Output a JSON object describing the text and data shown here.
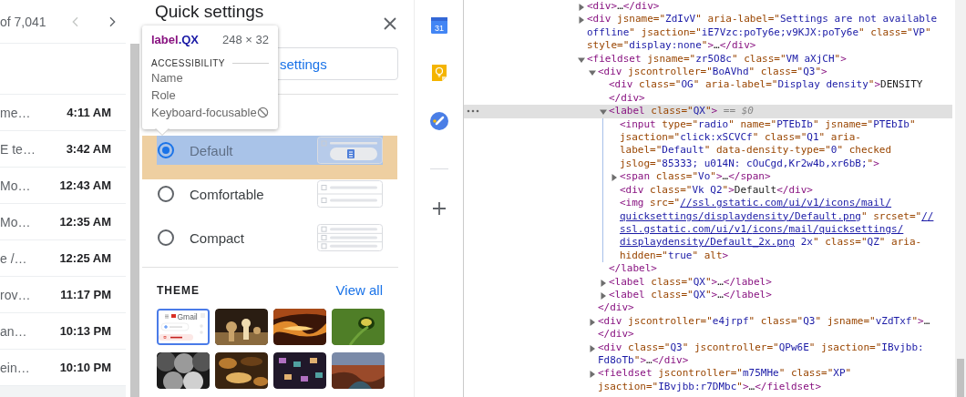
{
  "mail": {
    "count": "of 7,041",
    "nav": [
      {
        "kind": "prev",
        "disabled": true
      },
      {
        "kind": "next",
        "disabled": false
      }
    ],
    "rows": [
      {
        "snippet": "me…",
        "time": "4:11 AM",
        "unread": true
      },
      {
        "snippet": "E te…",
        "time": "3:42 AM",
        "unread": true
      },
      {
        "snippet": "Mo…",
        "time": "12:43 AM",
        "unread": true
      },
      {
        "snippet": "Mo…",
        "time": "12:35 AM",
        "unread": true
      },
      {
        "snippet": "e /…",
        "time": "12:25 AM",
        "unread": true
      },
      {
        "snippet": "rov…",
        "time": "11:17 PM",
        "unread": true
      },
      {
        "snippet": "an…",
        "time": "10:13 PM",
        "unread": true
      },
      {
        "snippet": "ein…",
        "time": "10:10 PM",
        "unread": true
      }
    ]
  },
  "quick_settings": {
    "title": "Quick settings",
    "settings_button": "settings",
    "density": [
      {
        "kind": "default",
        "label": "Default",
        "selected": true,
        "inspected": true
      },
      {
        "kind": "comfortable",
        "label": "Comfortable",
        "selected": false,
        "inspected": false
      },
      {
        "kind": "compact",
        "label": "Compact",
        "selected": false,
        "inspected": false
      }
    ],
    "theme_heading": "THEME",
    "view_all": "View all",
    "themes": [
      {
        "kind": "preview",
        "label": "Gmail",
        "selected": true
      },
      {
        "kind": "picture",
        "selected": false
      },
      {
        "kind": "picture",
        "selected": false
      },
      {
        "kind": "picture",
        "selected": false
      },
      {
        "kind": "picture",
        "selected": false
      },
      {
        "kind": "picture",
        "selected": false
      },
      {
        "kind": "picture",
        "selected": false
      },
      {
        "kind": "picture",
        "selected": false
      }
    ]
  },
  "inspect_tooltip": {
    "tag": "label",
    "class_name": ".QX",
    "size": "248 × 32",
    "section": "ACCESSIBILITY",
    "rows": [
      "Name",
      "Role",
      "Keyboard-focusable"
    ]
  },
  "side_rail": [
    {
      "kind": "calendar",
      "label": "31"
    },
    {
      "kind": "keep"
    },
    {
      "kind": "tasks"
    },
    {
      "kind": "divider"
    },
    {
      "kind": "add"
    }
  ],
  "devtools": {
    "nodes": [
      {
        "expanded": false,
        "tokens": [
          {
            "kind": "tag",
            "text": "<div>"
          },
          {
            "kind": "text",
            "text": "…"
          },
          {
            "kind": "tag",
            "text": "</div>"
          }
        ]
      },
      {
        "expanded": false,
        "tokens": [
          {
            "kind": "tag",
            "text": "<div"
          },
          {
            "kind": "attr",
            "text": " jsname=\""
          },
          {
            "kind": "value",
            "text": "ZdIvV"
          },
          {
            "kind": "attr",
            "text": "\" aria-label=\""
          },
          {
            "kind": "value",
            "text": "Settings are not available offline"
          },
          {
            "kind": "attr",
            "text": "\" jsaction=\""
          },
          {
            "kind": "value",
            "text": "iE7Vzc:poTy6e;v9KJX:poTy6e"
          },
          {
            "kind": "attr",
            "text": "\" class=\""
          },
          {
            "kind": "value",
            "text": "VP"
          },
          {
            "kind": "attr",
            "text": "\" style=\""
          },
          {
            "kind": "value",
            "text": "display:none"
          },
          {
            "kind": "attr",
            "text": "\""
          },
          {
            "kind": "tag",
            "text": ">"
          },
          {
            "kind": "text",
            "text": "…"
          },
          {
            "kind": "tag",
            "text": "</div>"
          }
        ]
      },
      {
        "expanded": true,
        "tokens": [
          {
            "kind": "tag",
            "text": "<fieldset"
          },
          {
            "kind": "attr",
            "text": " jsname=\""
          },
          {
            "kind": "value",
            "text": "zr5O8c"
          },
          {
            "kind": "attr",
            "text": "\" class=\""
          },
          {
            "kind": "value",
            "text": "VM aXjCH"
          },
          {
            "kind": "attr",
            "text": "\""
          },
          {
            "kind": "tag",
            "text": ">"
          }
        ],
        "children": [
          {
            "expanded": true,
            "tokens": [
              {
                "kind": "tag",
                "text": "<div"
              },
              {
                "kind": "attr",
                "text": " jscontroller=\""
              },
              {
                "kind": "value",
                "text": "BoAVhd"
              },
              {
                "kind": "attr",
                "text": "\" class=\""
              },
              {
                "kind": "value",
                "text": "Q3"
              },
              {
                "kind": "attr",
                "text": "\""
              },
              {
                "kind": "tag",
                "text": ">"
              }
            ],
            "close": [
              {
                "kind": "tag",
                "text": "</div>"
              }
            ],
            "children": [
              {
                "tokens": [
                  {
                    "kind": "tag",
                    "text": "<div"
                  },
                  {
                    "kind": "attr",
                    "text": " class=\""
                  },
                  {
                    "kind": "value",
                    "text": "OG"
                  },
                  {
                    "kind": "attr",
                    "text": "\" aria-label=\""
                  },
                  {
                    "kind": "value",
                    "text": "Display density"
                  },
                  {
                    "kind": "attr",
                    "text": "\""
                  },
                  {
                    "kind": "tag",
                    "text": ">"
                  },
                  {
                    "kind": "text",
                    "text": "DENSITY"
                  }
                ],
                "close": [
                  {
                    "kind": "tag",
                    "text": "</div>"
                  }
                ]
              },
              {
                "expanded": true,
                "selected": true,
                "tokens": [
                  {
                    "kind": "tag",
                    "text": "<label"
                  },
                  {
                    "kind": "attr",
                    "text": " class=\""
                  },
                  {
                    "kind": "value",
                    "text": "QX"
                  },
                  {
                    "kind": "attr",
                    "text": "\""
                  },
                  {
                    "kind": "tag",
                    "text": ">"
                  },
                  {
                    "kind": "hint",
                    "text": " == $0"
                  }
                ],
                "close": [
                  {
                    "kind": "tag",
                    "text": "</label>"
                  }
                ],
                "children": [
                  {
                    "tokens": [
                      {
                        "kind": "tag",
                        "text": "<input"
                      },
                      {
                        "kind": "attr",
                        "text": " type=\""
                      },
                      {
                        "kind": "value",
                        "text": "radio"
                      },
                      {
                        "kind": "attr",
                        "text": "\" name=\""
                      },
                      {
                        "kind": "value",
                        "text": "PTEbIb"
                      },
                      {
                        "kind": "attr",
                        "text": "\" jsname=\""
                      },
                      {
                        "kind": "value",
                        "text": "PTEbIb"
                      },
                      {
                        "kind": "attr",
                        "text": "\" jsaction=\""
                      },
                      {
                        "kind": "value",
                        "text": "click:xSCVCf"
                      },
                      {
                        "kind": "attr",
                        "text": "\" class=\""
                      },
                      {
                        "kind": "value",
                        "text": "Q1"
                      },
                      {
                        "kind": "attr",
                        "text": "\" aria-label=\""
                      },
                      {
                        "kind": "value",
                        "text": "Default"
                      },
                      {
                        "kind": "attr",
                        "text": "\" data-density-type=\""
                      },
                      {
                        "kind": "value",
                        "text": "0"
                      },
                      {
                        "kind": "attr",
                        "text": "\" checked jslog=\""
                      },
                      {
                        "kind": "value",
                        "text": "85333; u014N: cOuCgd,Kr2w4b,xr6bB;"
                      },
                      {
                        "kind": "attr",
                        "text": "\""
                      },
                      {
                        "kind": "tag",
                        "text": ">"
                      }
                    ]
                  },
                  {
                    "expanded": false,
                    "tokens": [
                      {
                        "kind": "tag",
                        "text": "<span"
                      },
                      {
                        "kind": "attr",
                        "text": " class=\""
                      },
                      {
                        "kind": "value",
                        "text": "Vo"
                      },
                      {
                        "kind": "attr",
                        "text": "\""
                      },
                      {
                        "kind": "tag",
                        "text": ">"
                      },
                      {
                        "kind": "text",
                        "text": "…"
                      },
                      {
                        "kind": "tag",
                        "text": "</span>"
                      }
                    ]
                  },
                  {
                    "tokens": [
                      {
                        "kind": "tag",
                        "text": "<div"
                      },
                      {
                        "kind": "attr",
                        "text": " class=\""
                      },
                      {
                        "kind": "value",
                        "text": "Vk Q2"
                      },
                      {
                        "kind": "attr",
                        "text": "\""
                      },
                      {
                        "kind": "tag",
                        "text": ">"
                      },
                      {
                        "kind": "text",
                        "text": "Default"
                      },
                      {
                        "kind": "tag",
                        "text": "</div>"
                      }
                    ]
                  },
                  {
                    "tokens": [
                      {
                        "kind": "tag",
                        "text": "<img"
                      },
                      {
                        "kind": "attr",
                        "text": " src=\""
                      },
                      {
                        "kind": "link",
                        "text": "//ssl.gstatic.com/ui/v1/icons/mail/quicksettings/displaydensity/Default.png"
                      },
                      {
                        "kind": "attr",
                        "text": "\" srcset=\""
                      },
                      {
                        "kind": "link",
                        "text": "//ssl.gstatic.com/ui/v1/icons/mail/quicksettings/displaydensity/Default_2x.png"
                      },
                      {
                        "kind": "value",
                        "text": " 2x"
                      },
                      {
                        "kind": "attr",
                        "text": "\" class=\""
                      },
                      {
                        "kind": "value",
                        "text": "QZ"
                      },
                      {
                        "kind": "attr",
                        "text": "\" aria-hidden=\""
                      },
                      {
                        "kind": "value",
                        "text": "true"
                      },
                      {
                        "kind": "attr",
                        "text": "\" alt"
                      },
                      {
                        "kind": "tag",
                        "text": ">"
                      }
                    ]
                  }
                ]
              },
              {
                "expanded": false,
                "tokens": [
                  {
                    "kind": "tag",
                    "text": "<label"
                  },
                  {
                    "kind": "attr",
                    "text": " class=\""
                  },
                  {
                    "kind": "value",
                    "text": "QX"
                  },
                  {
                    "kind": "attr",
                    "text": "\""
                  },
                  {
                    "kind": "tag",
                    "text": ">"
                  },
                  {
                    "kind": "text",
                    "text": "…"
                  },
                  {
                    "kind": "tag",
                    "text": "</label>"
                  }
                ]
              },
              {
                "expanded": false,
                "tokens": [
                  {
                    "kind": "tag",
                    "text": "<label"
                  },
                  {
                    "kind": "attr",
                    "text": " class=\""
                  },
                  {
                    "kind": "value",
                    "text": "QX"
                  },
                  {
                    "kind": "attr",
                    "text": "\""
                  },
                  {
                    "kind": "tag",
                    "text": ">"
                  },
                  {
                    "kind": "text",
                    "text": "…"
                  },
                  {
                    "kind": "tag",
                    "text": "</label>"
                  }
                ]
              }
            ]
          },
          {
            "expanded": false,
            "tokens": [
              {
                "kind": "tag",
                "text": "<div"
              },
              {
                "kind": "attr",
                "text": " jscontroller=\""
              },
              {
                "kind": "value",
                "text": "e4jrpf"
              },
              {
                "kind": "attr",
                "text": "\" class=\""
              },
              {
                "kind": "value",
                "text": "Q3"
              },
              {
                "kind": "attr",
                "text": "\" jsname=\""
              },
              {
                "kind": "value",
                "text": "vZdTxf"
              },
              {
                "kind": "attr",
                "text": "\""
              },
              {
                "kind": "tag",
                "text": ">"
              },
              {
                "kind": "text",
                "text": "…"
              },
              {
                "kind": "tag",
                "text": "</div>"
              }
            ]
          },
          {
            "expanded": false,
            "tokens": [
              {
                "kind": "tag",
                "text": "<div"
              },
              {
                "kind": "attr",
                "text": " class=\""
              },
              {
                "kind": "value",
                "text": "Q3"
              },
              {
                "kind": "attr",
                "text": "\" jscontroller=\""
              },
              {
                "kind": "value",
                "text": "QPw6E"
              },
              {
                "kind": "attr",
                "text": "\" jsaction=\""
              },
              {
                "kind": "value",
                "text": "IBvjbb: Fd8oTb"
              },
              {
                "kind": "attr",
                "text": "\""
              },
              {
                "kind": "tag",
                "text": ">"
              },
              {
                "kind": "text",
                "text": "…"
              },
              {
                "kind": "tag",
                "text": "</div>"
              }
            ]
          },
          {
            "expanded": false,
            "tokens": [
              {
                "kind": "tag",
                "text": "<fieldset"
              },
              {
                "kind": "attr",
                "text": " jscontroller=\""
              },
              {
                "kind": "value",
                "text": "m75MHe"
              },
              {
                "kind": "attr",
                "text": "\" class=\""
              },
              {
                "kind": "value",
                "text": "XP"
              },
              {
                "kind": "attr",
                "text": "\" jsaction=\""
              },
              {
                "kind": "value",
                "text": "IBvjbb:r7DMbc"
              },
              {
                "kind": "attr",
                "text": "\""
              },
              {
                "kind": "tag",
                "text": ">"
              },
              {
                "kind": "text",
                "text": "…"
              },
              {
                "kind": "tag",
                "text": "</fieldset>"
              }
            ]
          }
        ]
      }
    ]
  }
}
